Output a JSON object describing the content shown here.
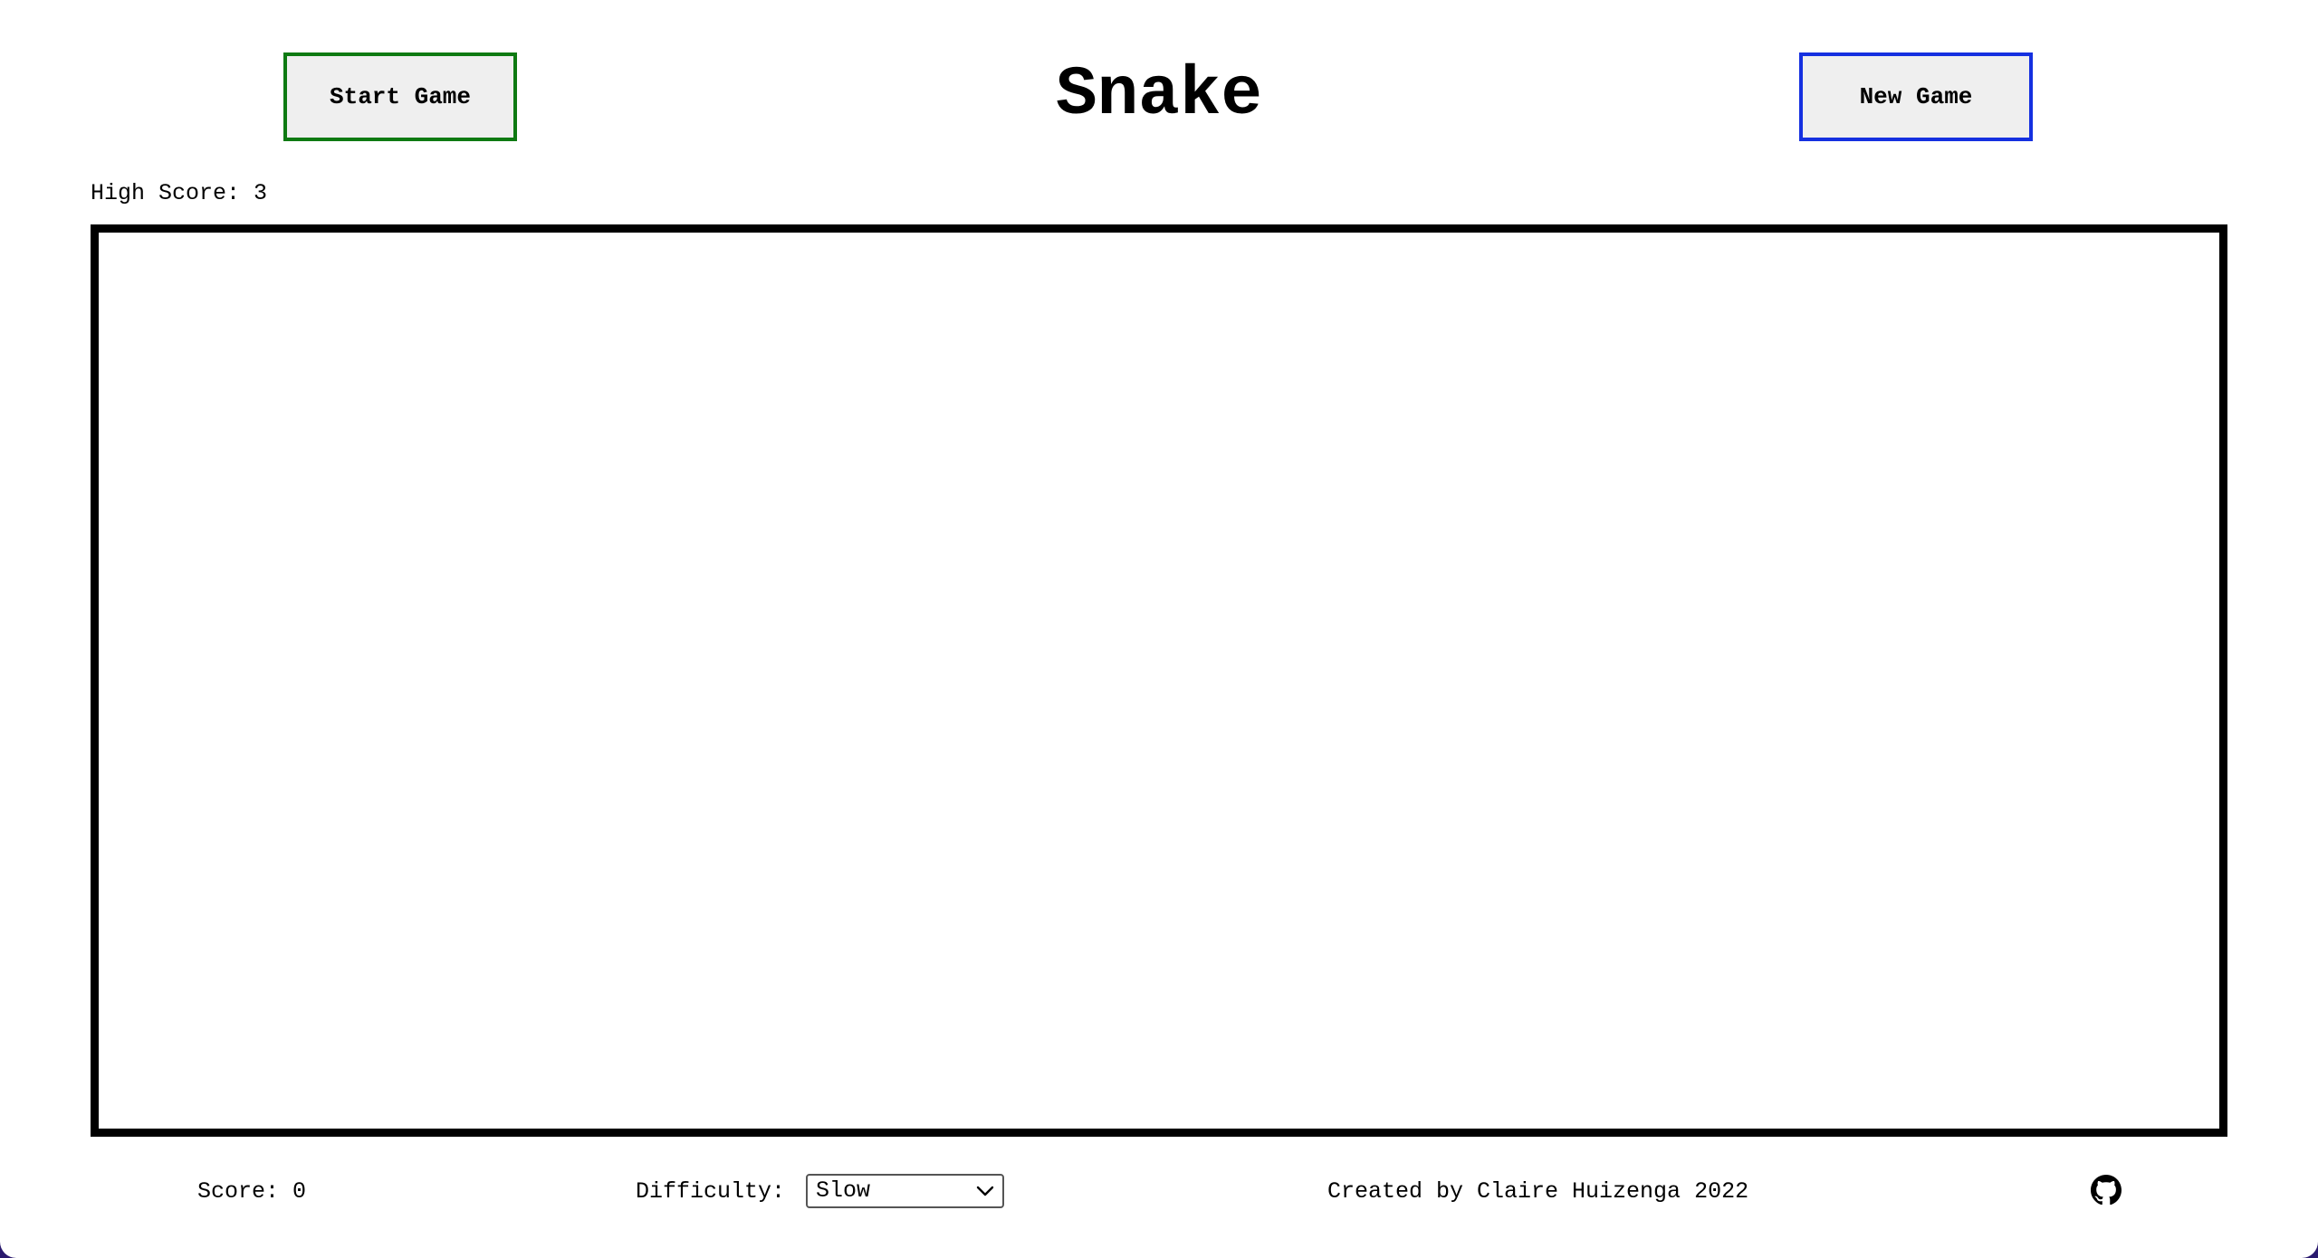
{
  "header": {
    "start_label": "Start Game",
    "title": "Snake",
    "new_label": "New Game"
  },
  "stats": {
    "high_score_text": "High Score: 3",
    "score_text": "Score: 0"
  },
  "controls": {
    "difficulty_label": "Difficulty:",
    "difficulty_value": "Slow"
  },
  "footer": {
    "credit": "Created by Claire Huizenga 2022"
  },
  "icons": {
    "select": "chevron-down-icon",
    "link": "github-icon"
  },
  "colors": {
    "start_border": "#0e7a12",
    "new_border": "#1530e0",
    "board_border": "#000000"
  }
}
